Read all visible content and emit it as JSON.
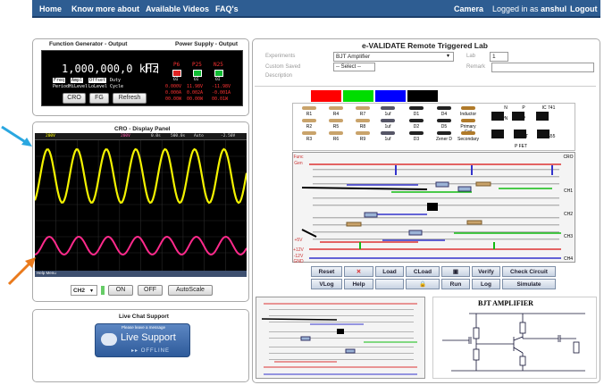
{
  "nav": {
    "home": "Home",
    "know_more": "Know more about",
    "videos": "Available Videos",
    "faq": "FAQ's",
    "camera": "Camera",
    "logged_in_prefix": "Logged in as",
    "username": "anshul",
    "logout": "Logout"
  },
  "function_generator": {
    "title": "Function Generator - Output",
    "frequency": "1,000,000,0 kHz",
    "modes": [
      "Freq",
      "Ampl",
      "Offset",
      "Duty"
    ],
    "mode_sublabels": [
      "Period",
      "HiLevel",
      "LoLevel",
      "Cycle"
    ],
    "buttons": {
      "cro": "CRO",
      "fg": "FG",
      "refresh": "Refresh"
    }
  },
  "power_supply": {
    "title": "Power Supply - Output",
    "channels": [
      {
        "name": "P6",
        "sub": "OI",
        "v": "0.000V",
        "a": "0.000A",
        "w": "00.00W"
      },
      {
        "name": "P25",
        "sub": "OI",
        "v": "11.98V",
        "a": "0.002A",
        "w": "00.00W"
      },
      {
        "name": "N25",
        "sub": "OI",
        "v": "-11.98V",
        "a": "-0.001A",
        "w": "00.01W"
      }
    ]
  },
  "cro": {
    "title": "CRO - Display Panel",
    "status": [
      "200V",
      "200V",
      "0.0s",
      "500.0s",
      "Auto",
      "-2.50V"
    ],
    "footer": "Help Menu",
    "channel": "CH2",
    "buttons": {
      "on": "ON",
      "off": "OFF",
      "autoscale": "AutoScale"
    },
    "trace1_color": "#f3f300",
    "trace2_color": "#ff2a8c"
  },
  "chat": {
    "title": "Live Chat Support",
    "banner_top": "Please leave a message",
    "banner_main": "Live Support",
    "banner_status": "OFFLINE"
  },
  "lab": {
    "title": "e-VALIDATE Remote Triggered Lab",
    "experiments_label": "Experiments",
    "experiment_value": "BJT Amplifier",
    "lab_label": "Lab",
    "lab_value": "1",
    "custom_saved_label": "Custom Saved",
    "description_label": "Description",
    "select_value": "-- Select --",
    "remark_label": "Remark",
    "swatches": [
      "#ff0000",
      "#00dd00",
      "#0000ff",
      "#000000"
    ],
    "components_row1": [
      "R1",
      "R4",
      "R7",
      "1uf",
      "D1",
      "D4",
      "Inductor"
    ],
    "components_row2": [
      "R2",
      "R5",
      "R8",
      "1uf",
      "D2",
      "D5",
      "Primary Coil"
    ],
    "components_row3": [
      "R3",
      "R6",
      "R9",
      "1uf",
      "D3",
      "Zener D",
      "Secondary"
    ],
    "ic_labels": [
      "N",
      "NPN",
      "P",
      "PNP",
      "IC 741",
      "N FET",
      "P FET",
      "IC 555"
    ],
    "board_labels_left": [
      "Func",
      "Gen",
      "+5V",
      "+12V",
      "-12V",
      "GND"
    ],
    "board_labels_right": [
      "CRO",
      "CH1",
      "CH2",
      "CH3",
      "CH4"
    ],
    "buttons_row1": [
      "Reset",
      "✕",
      "Load",
      "CLoad",
      "▣",
      "Verify",
      "Check Circuit"
    ],
    "buttons_row2": [
      "VLog",
      "Help",
      "",
      "🔒",
      "Run",
      "Log",
      "Simulate"
    ],
    "schematic_title": "BJT AMPLIFIER"
  }
}
